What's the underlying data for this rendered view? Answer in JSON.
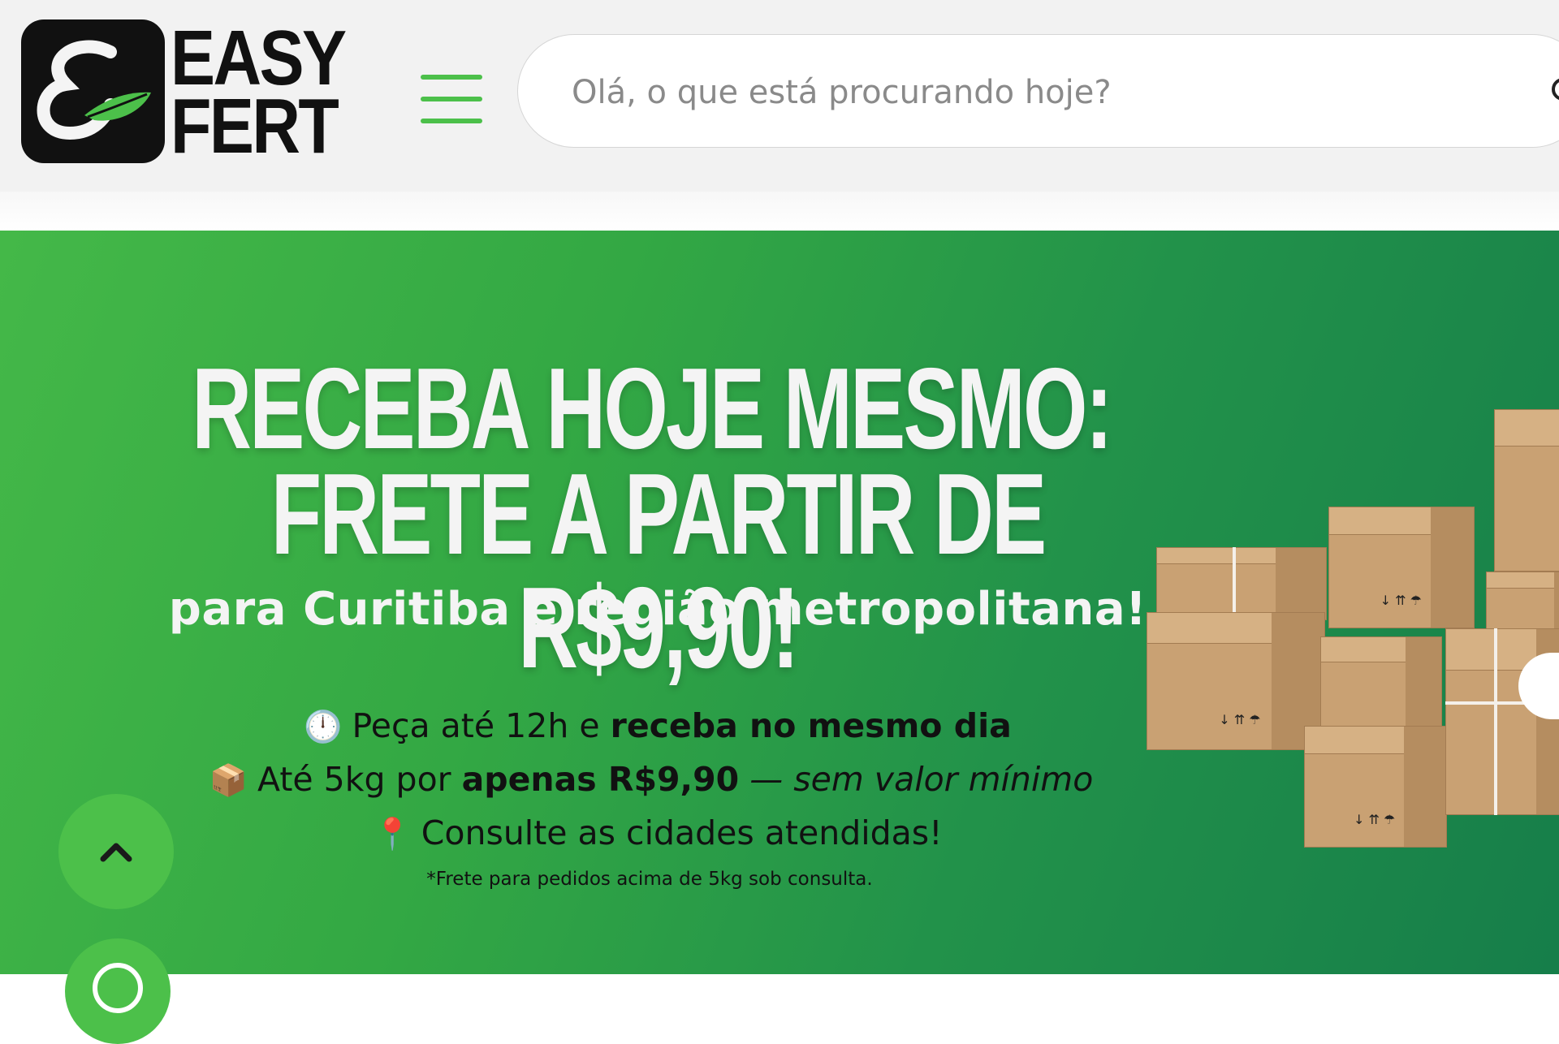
{
  "header": {
    "logo": {
      "line1": "EASY",
      "line2": "FERT"
    },
    "menu_icon": "hamburger-menu-icon",
    "search": {
      "placeholder": "Olá, o que está procurando hoje?",
      "value": "",
      "icon": "search-icon"
    }
  },
  "banner": {
    "title_line1": "RECEBA HOJE MESMO:",
    "title_line2": "FRETE A PARTIR DE R$9,90!",
    "subtitle": "para Curitiba e região metropolitana!",
    "lines": [
      {
        "emoji": "🕛",
        "text": "Peça até 12h e ",
        "bold": "receba no mesmo dia",
        "italic": ""
      },
      {
        "emoji": "📦",
        "text": "Até 5kg por ",
        "bold": "apenas R$9,90",
        "italic": " — sem valor mínimo"
      },
      {
        "emoji": "📍",
        "text": "Consulte as cidades atendidas!",
        "bold": "",
        "italic": ""
      }
    ],
    "note": "*Frete para pedidos acima de 5kg sob consulta.",
    "box_marks": "↓ ⇈ ☂",
    "colors": {
      "gradient_start": "#44b848",
      "gradient_end": "#167e4a",
      "accent": "#4cc04a"
    }
  },
  "floating": {
    "scroll_top_icon": "chevron-up-icon",
    "whatsapp_icon": "whatsapp-icon"
  }
}
